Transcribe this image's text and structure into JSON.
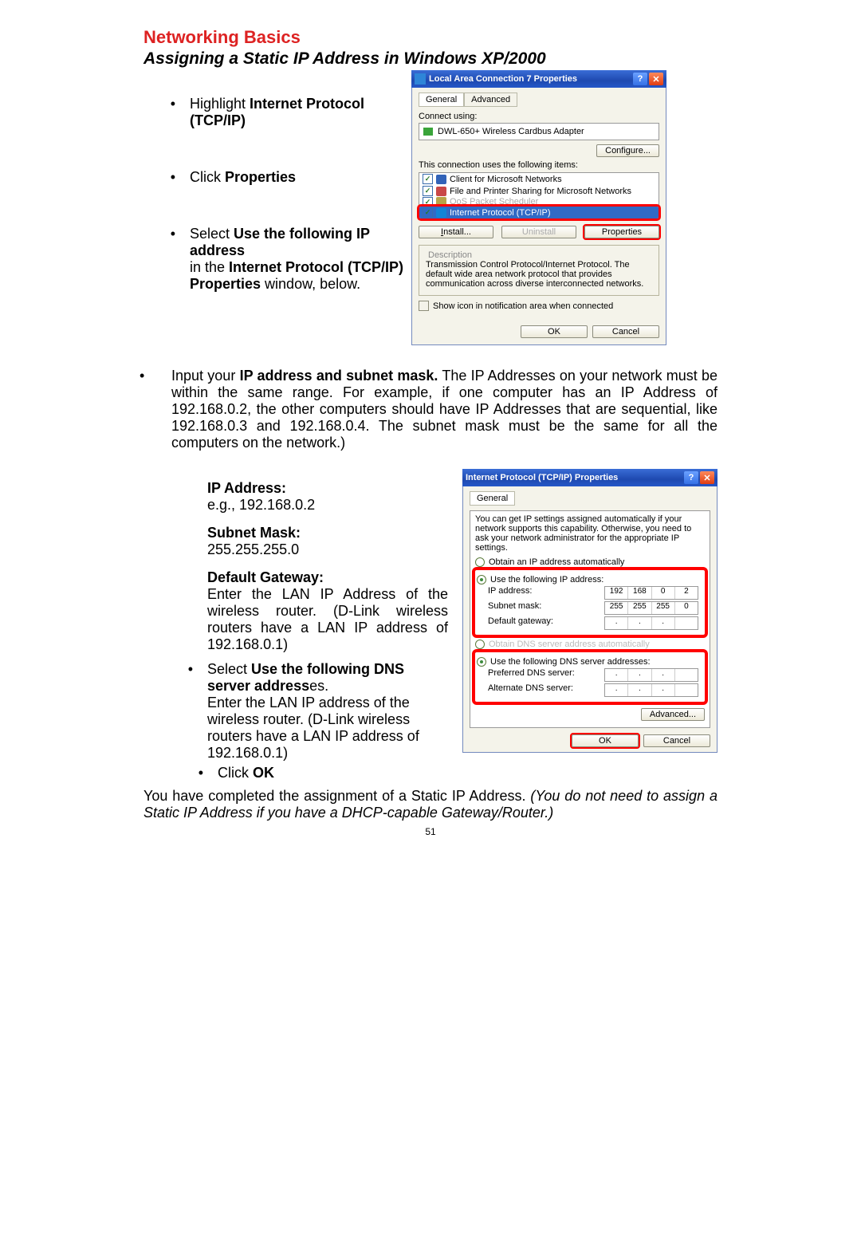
{
  "heading": "Networking Basics",
  "subtitle": "Assigning a Static IP Address in Windows XP/2000",
  "page_num": "51",
  "sec1": {
    "b1a": "Highlight ",
    "b1b": "Internet Protocol (TCP/IP)",
    "b2a": "Click ",
    "b2b": "Properties",
    "b3a": "Select ",
    "b3b": "Use the following IP address",
    "b3c": "in the ",
    "b3d": "Internet Protocol (TCP/IP) Properties",
    "b3e": " window, below."
  },
  "dlg1": {
    "title": "Local Area Connection 7 Properties",
    "tab_general": "General",
    "tab_advanced": "Advanced",
    "connect_using": "Connect using:",
    "adapter": "DWL-650+ Wireless Cardbus Adapter",
    "configure": "Configure...",
    "items_label": "This connection uses the following items:",
    "item1": "Client for Microsoft Networks",
    "item2": "File and Printer Sharing for Microsoft Networks",
    "item3": "QoS Packet Scheduler",
    "item4": "Internet Protocol (TCP/IP)",
    "install": "Install...",
    "uninstall": "Uninstall",
    "properties": "Properties",
    "desc_label": "Description",
    "desc": "Transmission Control Protocol/Internet Protocol. The default wide area network protocol that provides communication across diverse interconnected networks.",
    "show_icon": "Show icon in notification area when connected",
    "ok": "OK",
    "cancel": "Cancel"
  },
  "para1": {
    "a": "Input your ",
    "b": "IP address and subnet mask.",
    "c": " The IP Addresses on your network must be within the same range. For example, if one computer has an IP Address of 192.168.0.2, the other computers should have IP Addresses that are sequential, like 192.168.0.3 and 192.168.0.4. The subnet mask must be the same for all the computers on the network.)"
  },
  "sec2": {
    "ip_lbl": "IP Address:",
    "ip_eg": "e.g., 192.168.0.2",
    "sm_lbl": "Subnet Mask:",
    "sm_val": "255.255.255.0",
    "gw_lbl": "Default Gateway:",
    "gw_txt": "Enter the LAN IP Address of the wireless router.  (D-Link wireless routers have a LAN IP address of 192.168.0.1)",
    "dns_a": "Select ",
    "dns_b": "Use the following DNS server address",
    "dns_c": "es.",
    "dns_txt": "Enter the LAN IP address of the wireless router. (D-Link wireless routers have a LAN IP address of 192.168.0.1)"
  },
  "dlg2": {
    "title": "Internet Protocol (TCP/IP) Properties",
    "tab_general": "General",
    "blurb": "You can get IP settings assigned automatically if your network supports this capability. Otherwise, you need to ask your network administrator for the appropriate IP settings.",
    "r1": "Obtain an IP address automatically",
    "r2": "Use the following IP address:",
    "ip_lbl": "IP address:",
    "ip_v": [
      "192",
      "168",
      "0",
      "2"
    ],
    "sm_lbl": "Subnet mask:",
    "sm_v": [
      "255",
      "255",
      "255",
      "0"
    ],
    "gw_lbl": "Default gateway:",
    "r3": "Obtain DNS server address automatically",
    "r4": "Use the following DNS server addresses:",
    "pdns": "Preferred DNS server:",
    "adns": "Alternate DNS server:",
    "advanced": "Advanced...",
    "ok": "OK",
    "cancel": "Cancel"
  },
  "click_ok_a": "Click ",
  "click_ok_b": "OK",
  "final": {
    "a": "You have completed the assignment of a Static IP Address.  ",
    "b": "(You do not need to assign a Static IP Address if you have a DHCP-capable Gateway/Router.)"
  }
}
